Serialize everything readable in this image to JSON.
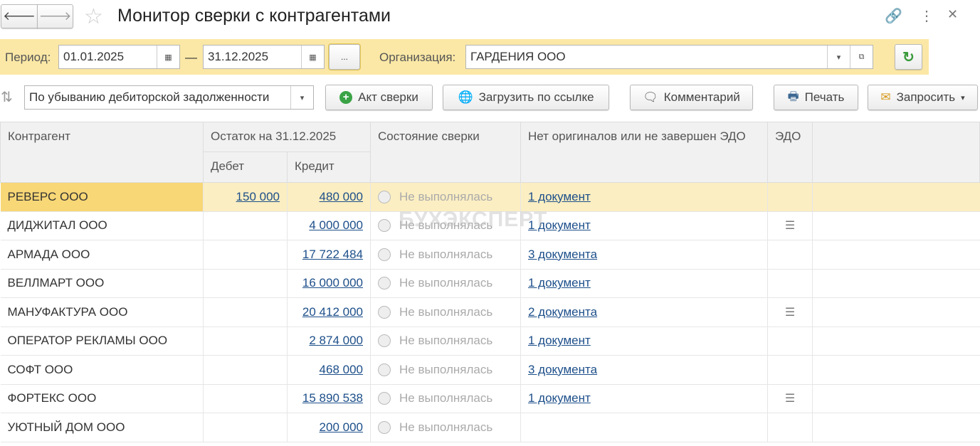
{
  "window": {
    "title": "Монитор сверки с контрагентами"
  },
  "filters": {
    "period_label": "Период:",
    "date_from": "01.01.2025",
    "dash": "—",
    "date_to": "31.12.2025",
    "more_label": "...",
    "org_label": "Организация:",
    "org_value": "ГАРДЕНИЯ ООО"
  },
  "toolbar": {
    "sort_value": "По убыванию дебиторской задолженности",
    "act_label": "Акт сверки",
    "load_label": "Загрузить по ссылке",
    "comment_label": "Комментарий",
    "print_label": "Печать",
    "request_label": "Запросить"
  },
  "table": {
    "headers": {
      "counterparty": "Контрагент",
      "balance": "Остаток на 31.12.2025",
      "debit": "Дебет",
      "credit": "Кредит",
      "status": "Состояние сверки",
      "originals": "Нет оригиналов или не завершен ЭДО",
      "edo": "ЭДО"
    },
    "rows": [
      {
        "name": "РЕВЕРС ООО",
        "debit": "150 000",
        "credit": "480 000",
        "status": "Не выполнялась",
        "docs": "1 документ",
        "edo": false
      },
      {
        "name": "ДИДЖИТАЛ ООО",
        "debit": "",
        "credit": "4 000 000",
        "status": "Не выполнялась",
        "docs": "1 документ",
        "edo": true
      },
      {
        "name": "АРМАДА ООО",
        "debit": "",
        "credit": "17 722 484",
        "status": "Не выполнялась",
        "docs": "3 документа",
        "edo": false
      },
      {
        "name": "ВЕЛЛМАРТ ООО",
        "debit": "",
        "credit": "16 000 000",
        "status": "Не выполнялась",
        "docs": "1 документ",
        "edo": false
      },
      {
        "name": "МАНУФАКТУРА ООО",
        "debit": "",
        "credit": "20 412 000",
        "status": "Не выполнялась",
        "docs": "2 документа",
        "edo": true
      },
      {
        "name": "ОПЕРАТОР РЕКЛАМЫ ООО",
        "debit": "",
        "credit": "2 874 000",
        "status": "Не выполнялась",
        "docs": "1 документ",
        "edo": false
      },
      {
        "name": "СОФТ ООО",
        "debit": "",
        "credit": "468 000",
        "status": "Не выполнялась",
        "docs": "3 документа",
        "edo": false
      },
      {
        "name": "ФОРТЕКС ООО",
        "debit": "",
        "credit": "15 890 538",
        "status": "Не выполнялась",
        "docs": "1 документ",
        "edo": true
      },
      {
        "name": "УЮТНЫЙ ДОМ ООО",
        "debit": "",
        "credit": "200 000",
        "status": "Не выполнялась",
        "docs": "",
        "edo": false
      }
    ]
  },
  "watermark": "БУХЭКСПЕРТ"
}
